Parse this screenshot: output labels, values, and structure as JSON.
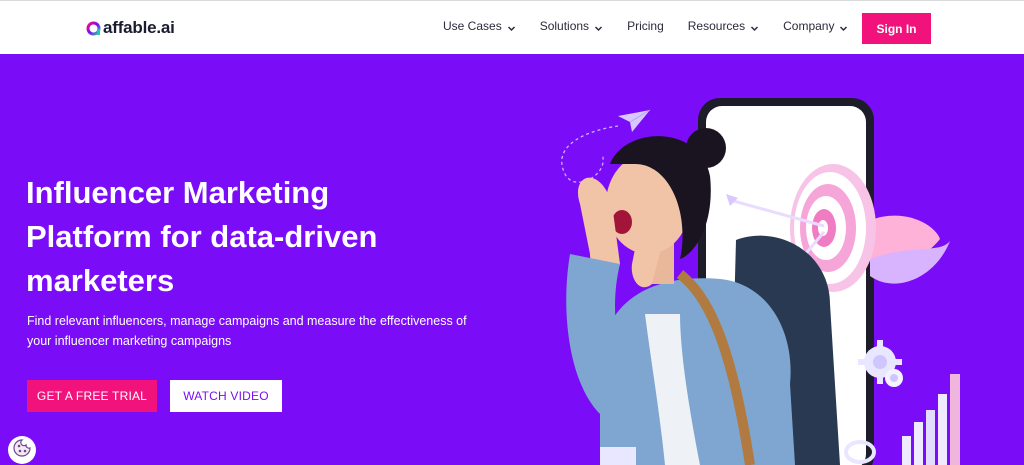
{
  "brand": {
    "logo_text": "affable.ai",
    "accent_color": "#f2127c",
    "hero_color": "#7b0cf7"
  },
  "nav": {
    "items": [
      {
        "label": "Use Cases",
        "has_dropdown": true
      },
      {
        "label": "Solutions",
        "has_dropdown": true
      },
      {
        "label": "Pricing",
        "has_dropdown": false
      },
      {
        "label": "Resources",
        "has_dropdown": true
      },
      {
        "label": "Company",
        "has_dropdown": true
      }
    ],
    "signin_label": "Sign In"
  },
  "hero": {
    "headline_lines": [
      "Influencer Marketing",
      "Platform for data-driven",
      "marketers"
    ],
    "subtext": "Find relevant influencers, manage campaigns and measure the effectiveness of your influencer marketing campaigns",
    "primary_cta": "GET A FREE TRIAL",
    "secondary_cta": "WATCH VIDEO"
  },
  "icons": {
    "cookie": "cookie-icon",
    "chevron": "chevron-down-icon"
  }
}
